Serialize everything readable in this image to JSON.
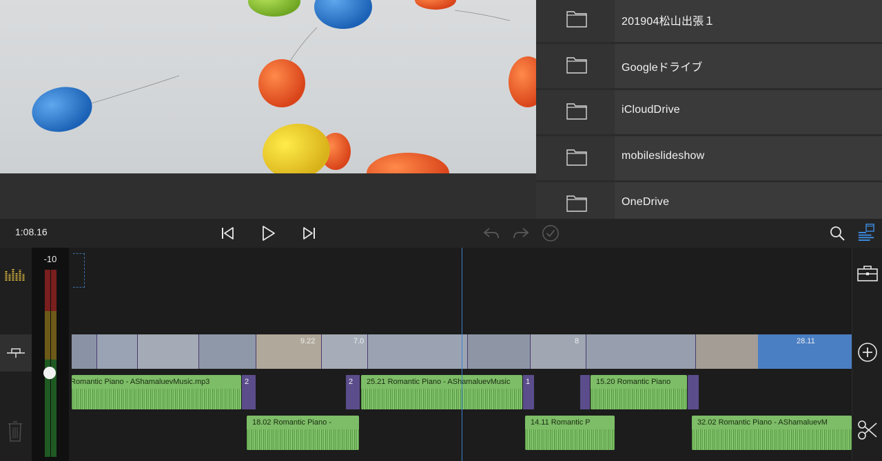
{
  "browser": {
    "items": [
      {
        "label": "201904松山出張１"
      },
      {
        "label": "Googleドライブ"
      },
      {
        "label": "iCloudDrive"
      },
      {
        "label": "mobileslideshow"
      },
      {
        "label": "OneDrive"
      }
    ]
  },
  "toolbar": {
    "timecode": "1:08.16",
    "icons": [
      "skip-back-icon",
      "play-icon",
      "skip-forward-icon",
      "undo-icon",
      "redo-icon",
      "done-check-icon",
      "search-icon",
      "timeline-view-icon"
    ]
  },
  "meter": {
    "label": "-10",
    "level": 0.55
  },
  "video_track": {
    "labels": [
      "9.22",
      "7.0",
      "8",
      "28.11"
    ]
  },
  "audio_track_1": {
    "clips": [
      {
        "text": "Romantic Piano - AShamaluevMusic.mp3"
      },
      {
        "text": "25.21  Romantic Piano - AShamaluevMusic"
      },
      {
        "text": "15.20  Romantic Piano"
      }
    ],
    "transitions": [
      "2",
      "2",
      "1"
    ]
  },
  "audio_track_2": {
    "clips": [
      {
        "text": "18.02  Romantic Piano -"
      },
      {
        "text": "14.11  Romantic P"
      },
      {
        "text": "32.02  Romantic Piano - AShamaluevM"
      }
    ]
  },
  "colors": {
    "accent": "#3d7fd1",
    "audio_clip": "#7dbd67",
    "transition": "#5b4d8c",
    "folder_row": "#3a3a3a"
  }
}
